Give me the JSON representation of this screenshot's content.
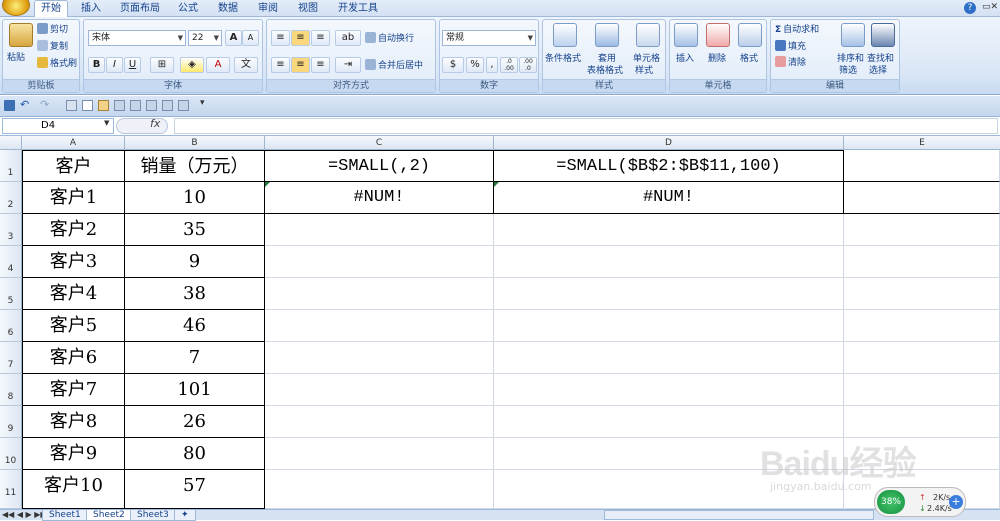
{
  "tabs": [
    "开始",
    "插入",
    "页面布局",
    "公式",
    "数据",
    "审阅",
    "视图",
    "开发工具"
  ],
  "clipboard": {
    "paste": "粘贴",
    "cut": "剪切",
    "copy": "复制",
    "format_painter": "格式刷",
    "title": "剪贴板"
  },
  "font": {
    "name": "宋体",
    "size": "22",
    "title": "字体",
    "bold": "B",
    "italic": "I",
    "underline": "U",
    "grow": "A",
    "shrink": "A"
  },
  "alignment": {
    "wrap": "自动换行",
    "merge": "合并后居中",
    "title": "对齐方式"
  },
  "number": {
    "format": "常规",
    "title": "数字",
    "percent": "%",
    "comma": ",",
    "inc_dec": ".0 .00",
    "dec_dec": ".00 .0"
  },
  "styles": {
    "conditional": "条件格式",
    "table_l1": "套用",
    "table_l2": "表格格式",
    "cell_l1": "单元格",
    "cell_l2": "样式",
    "title": "样式"
  },
  "cells": {
    "insert": "插入",
    "delete": "删除",
    "format": "格式",
    "title": "单元格"
  },
  "editing": {
    "autosum": "自动求和",
    "fill": "填充",
    "clear": "清除",
    "sort_l1": "排序和",
    "sort_l2": "筛选",
    "find_l1": "查找和",
    "find_l2": "选择",
    "title": "编辑"
  },
  "namebox": "D4",
  "fx": "fx",
  "columns": [
    "A",
    "B",
    "C",
    "D",
    "E"
  ],
  "rows": [
    "1",
    "2",
    "3",
    "4",
    "5",
    "6",
    "7",
    "8",
    "9",
    "10",
    "11"
  ],
  "table": {
    "header": [
      "客户",
      "销量（万元）"
    ],
    "rows": [
      [
        "客户1",
        "10"
      ],
      [
        "客户2",
        "35"
      ],
      [
        "客户3",
        "9"
      ],
      [
        "客户4",
        "38"
      ],
      [
        "客户5",
        "46"
      ],
      [
        "客户6",
        "7"
      ],
      [
        "客户7",
        "101"
      ],
      [
        "客户8",
        "26"
      ],
      [
        "客户9",
        "80"
      ],
      [
        "客户10",
        "57"
      ]
    ]
  },
  "formulas": {
    "c1": "=SMALL(,2)",
    "d1": "=SMALL($B$2:$B$11,100)",
    "c2": "#NUM!",
    "d2": "#NUM!"
  },
  "sheets": [
    "Sheet1",
    "Sheet2",
    "Sheet3"
  ],
  "net": {
    "percent": "38%",
    "up": "2K/s",
    "down": "2.4K/s"
  },
  "watermark": {
    "logo": "Baidu经验",
    "url": "jingyan.baidu.com"
  }
}
